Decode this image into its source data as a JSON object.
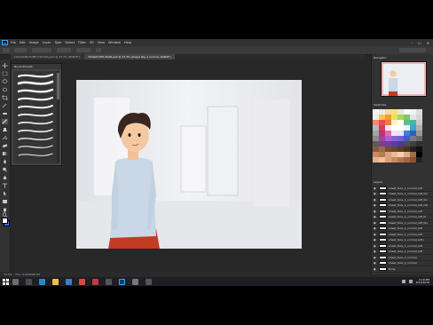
{
  "window": {
    "app_logo": "Ps"
  },
  "menu": [
    "File",
    "Edit",
    "Image",
    "Layer",
    "Type",
    "Select",
    "Filter",
    "3D",
    "View",
    "Window",
    "Help"
  ],
  "window_controls": {
    "minimize": "–",
    "maximize": "☐",
    "close": "✕"
  },
  "tabs": [
    {
      "label": "LOCATION HOME (HOUSE).psd @ 33.3% (RGB/8*)"
    },
    {
      "label": "CHARACTER MAIN.psd @ 33.3% (shape Key 1 normal, RGB/8*)"
    }
  ],
  "brush_panel": {
    "title": "Brush Presets"
  },
  "status": {
    "zoom": "33.3%",
    "doc": "Doc: 2.64M/98.1M"
  },
  "right_dock": {
    "navigator_title": "Navigator",
    "swatches_title": "Swatches",
    "layers_title": "Layers"
  },
  "layers": [
    "sheet_face_1_normal_left",
    "sheet_face_1_normal_left_blu",
    "sheet_face_1_normal_left_blu",
    "sheet_face_1_normal_left_hat",
    "sheet_face_1_normal_left",
    "sheet_face_1_normal_left_bl",
    "sheet_face_1_normal_left_blu",
    "sheet_face_1_normal_left",
    "sheet_face_1_normal_left",
    "sheet_face_1_normal_left_l",
    "sheet_face_1_normal_left",
    "sheet_face_1_normal_left",
    "sheet_face_1_normal",
    "sheet_face_1_normal",
    "Body"
  ],
  "taskbar": {
    "time": "3:19 PM",
    "date": "4/11/2016"
  },
  "colors": {
    "accent": "#31a8ff",
    "panel_bg": "#323232",
    "app_bg": "#282828"
  },
  "icons": [
    "ps-logo-icon",
    "move-tool-icon",
    "marquee-tool-icon",
    "lasso-tool-icon",
    "brush-tool-icon",
    "eraser-tool-icon",
    "zoom-tool-icon",
    "windows-start-icon",
    "eye-icon"
  ]
}
